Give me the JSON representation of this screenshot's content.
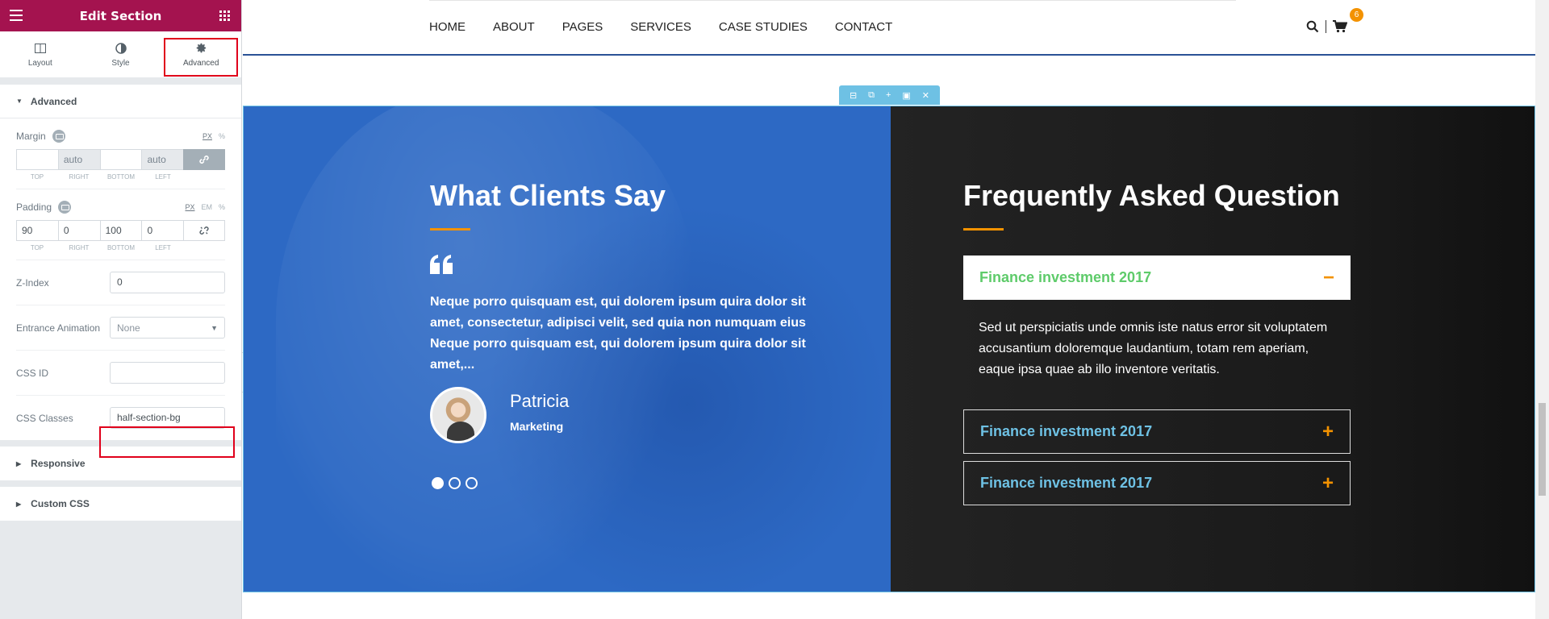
{
  "panel": {
    "title": "Edit Section",
    "tabs": [
      {
        "label": "Layout",
        "icon": "layout-icon"
      },
      {
        "label": "Style",
        "icon": "contrast-icon"
      },
      {
        "label": "Advanced",
        "icon": "gear-icon"
      }
    ],
    "advanced_heading": "Advanced",
    "margin": {
      "label": "Margin",
      "units": [
        "PX",
        "%"
      ],
      "values": [
        "",
        "auto",
        "",
        "auto"
      ],
      "sides": [
        "TOP",
        "RIGHT",
        "BOTTOM",
        "LEFT"
      ]
    },
    "padding": {
      "label": "Padding",
      "units": [
        "PX",
        "EM",
        "%"
      ],
      "values": [
        "90",
        "0",
        "100",
        "0"
      ],
      "sides": [
        "TOP",
        "RIGHT",
        "BOTTOM",
        "LEFT"
      ]
    },
    "z_index": {
      "label": "Z-Index",
      "value": "0"
    },
    "entrance_animation": {
      "label": "Entrance Animation",
      "value": "None"
    },
    "css_id": {
      "label": "CSS ID",
      "value": ""
    },
    "css_classes": {
      "label": "CSS Classes",
      "value": "half-section-bg"
    },
    "responsive": "Responsive",
    "custom_css": "Custom CSS"
  },
  "site": {
    "nav": [
      "HOME",
      "ABOUT",
      "PAGES",
      "SERVICES",
      "CASE STUDIES",
      "CONTACT"
    ],
    "cart_count": "6",
    "testimonials": {
      "heading": "What Clients Say",
      "text": "Neque porro quisquam est, qui dolorem ipsum quira dolor sit amet, consectetur, adipisci velit, sed quia non numquam eius Neque porro quisquam est, qui dolorem ipsum quira dolor sit amet,...",
      "name": "Patricia",
      "role": "Marketing"
    },
    "faq": {
      "heading": "Frequently Asked Question",
      "items": [
        {
          "title": "Finance investment 2017",
          "sign": "−"
        },
        {
          "title": "Finance investment 2017",
          "sign": "+"
        },
        {
          "title": "Finance investment 2017",
          "sign": "+"
        }
      ],
      "open_text": "Sed ut perspiciatis unde omnis iste natus error sit voluptatem accusantium doloremque laudantium, totam rem aperiam, eaque ipsa quae ab illo inventore veritatis."
    }
  },
  "colors": {
    "panel_header": "#a4134f",
    "highlight": "#e0001b",
    "section_blue": "#2d69c4",
    "accent_orange": "#f39200",
    "faq_open_green": "#5ecb6a",
    "faq_closed_blue": "#6ec1e4"
  }
}
